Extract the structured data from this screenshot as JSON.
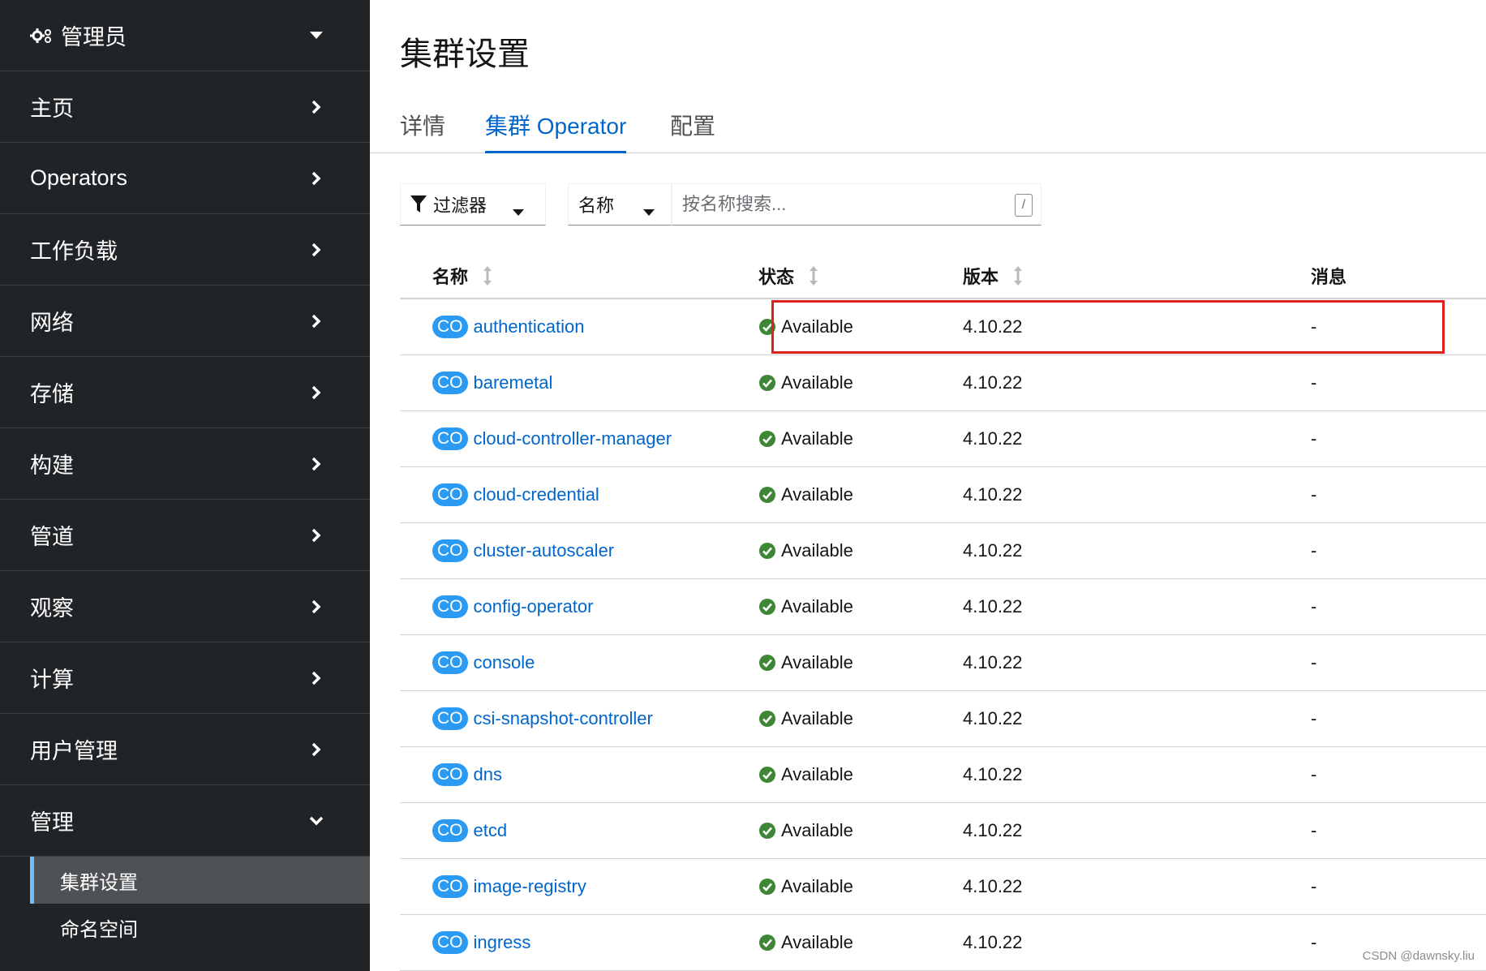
{
  "sidebar": {
    "perspective_label": "管理员",
    "items": [
      {
        "label": "主页"
      },
      {
        "label": "Operators"
      },
      {
        "label": "工作负载"
      },
      {
        "label": "网络"
      },
      {
        "label": "存储"
      },
      {
        "label": "构建"
      },
      {
        "label": "管道"
      },
      {
        "label": "观察"
      },
      {
        "label": "计算"
      },
      {
        "label": "用户管理"
      },
      {
        "label": "管理"
      }
    ],
    "subitems": [
      {
        "label": "集群设置",
        "active": true
      },
      {
        "label": "命名空间",
        "active": false
      }
    ]
  },
  "page": {
    "title": "集群设置",
    "tabs": [
      {
        "label": "详情",
        "active": false
      },
      {
        "label": "集群 Operator",
        "active": true
      },
      {
        "label": "配置",
        "active": false
      }
    ]
  },
  "toolbar": {
    "filter_label": "过滤器",
    "name_select": "名称",
    "search_placeholder": "按名称搜索...",
    "shortcut_key": "/"
  },
  "table": {
    "headers": {
      "name": "名称",
      "status": "状态",
      "version": "版本",
      "message": "消息"
    },
    "badge": "CO",
    "rows": [
      {
        "name": "authentication",
        "status": "Available",
        "version": "4.10.22",
        "message": "-"
      },
      {
        "name": "baremetal",
        "status": "Available",
        "version": "4.10.22",
        "message": "-"
      },
      {
        "name": "cloud-controller-manager",
        "status": "Available",
        "version": "4.10.22",
        "message": "-"
      },
      {
        "name": "cloud-credential",
        "status": "Available",
        "version": "4.10.22",
        "message": "-"
      },
      {
        "name": "cluster-autoscaler",
        "status": "Available",
        "version": "4.10.22",
        "message": "-"
      },
      {
        "name": "config-operator",
        "status": "Available",
        "version": "4.10.22",
        "message": "-"
      },
      {
        "name": "console",
        "status": "Available",
        "version": "4.10.22",
        "message": "-"
      },
      {
        "name": "csi-snapshot-controller",
        "status": "Available",
        "version": "4.10.22",
        "message": "-"
      },
      {
        "name": "dns",
        "status": "Available",
        "version": "4.10.22",
        "message": "-"
      },
      {
        "name": "etcd",
        "status": "Available",
        "version": "4.10.22",
        "message": "-"
      },
      {
        "name": "image-registry",
        "status": "Available",
        "version": "4.10.22",
        "message": "-"
      },
      {
        "name": "ingress",
        "status": "Available",
        "version": "4.10.22",
        "message": "-"
      }
    ]
  },
  "watermark": "CSDN @dawnsky.liu",
  "colors": {
    "sidebar_bg": "#212427",
    "link": "#0066cc",
    "badge": "#2b9af3",
    "success": "#3e8635",
    "highlight": "#e0201b"
  }
}
